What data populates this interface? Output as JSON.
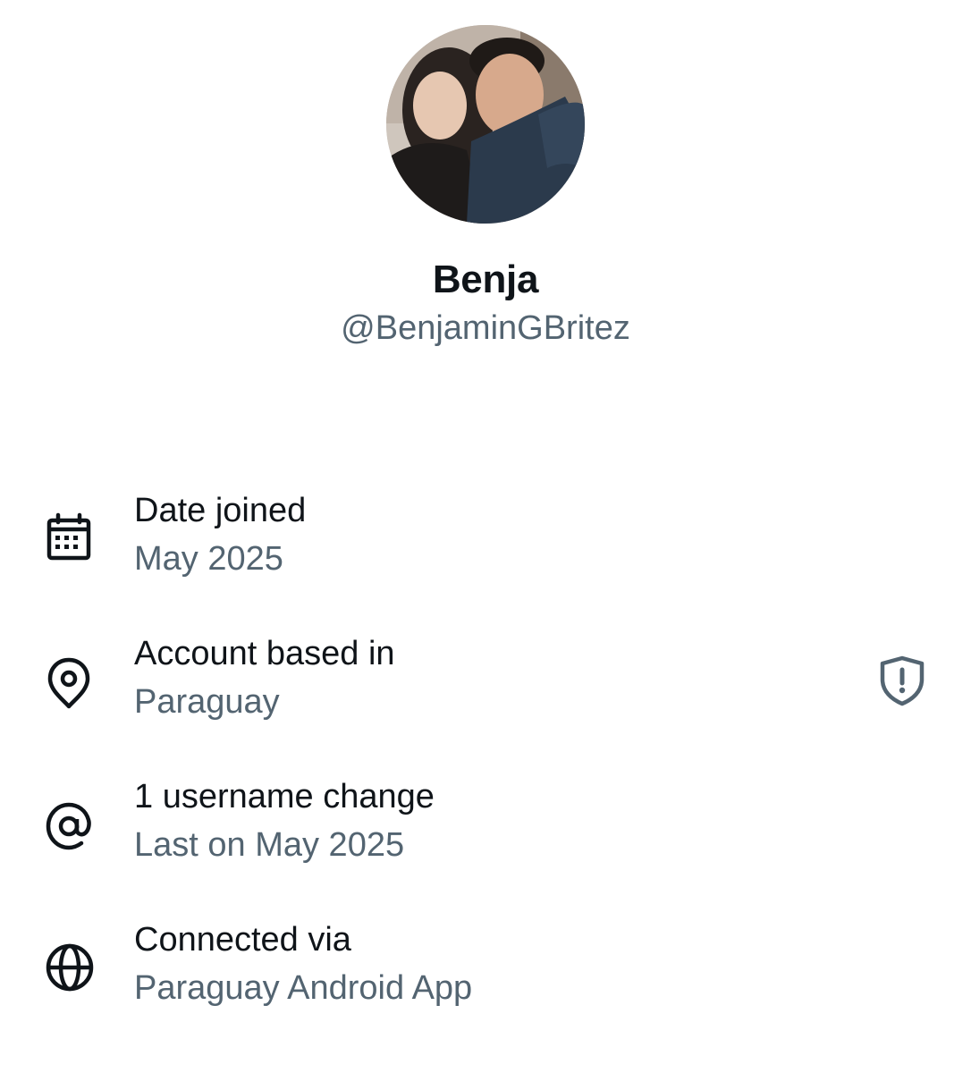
{
  "profile": {
    "display_name": "Benja",
    "handle": "@BenjaminGBritez"
  },
  "about": {
    "rows": [
      {
        "icon": "calendar-icon",
        "title": "Date joined",
        "value": "May 2025"
      },
      {
        "icon": "location-pin-icon",
        "title": "Account based in",
        "value": "Paraguay",
        "trailing_icon": "shield-alert-icon"
      },
      {
        "icon": "at-sign-icon",
        "title": "1 username change",
        "value": "Last on May 2025"
      },
      {
        "icon": "globe-icon",
        "title": "Connected via",
        "value": "Paraguay Android App"
      }
    ]
  },
  "colors": {
    "primary_text": "#0f1419",
    "secondary_text": "#536471",
    "background": "#ffffff"
  }
}
